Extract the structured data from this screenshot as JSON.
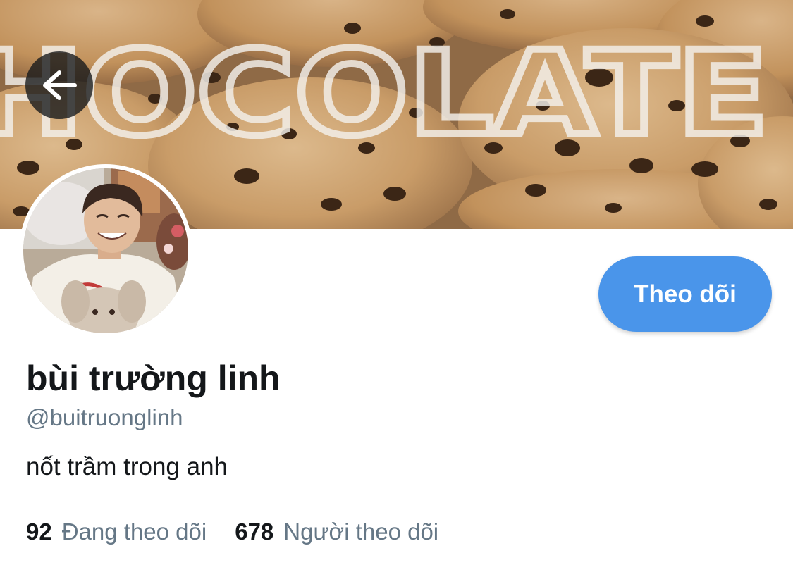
{
  "header": {
    "back_icon": "arrow-left-icon",
    "banner_text": "HOCOLATE"
  },
  "profile": {
    "display_name": "bùi trường linh",
    "handle": "@buitruonglinh",
    "bio": "nốt trầm trong anh",
    "follow_label": "Theo dõi"
  },
  "stats": {
    "following_count": "92",
    "following_label": "Đang theo dõi",
    "followers_count": "678",
    "followers_label": "Người theo dõi"
  },
  "colors": {
    "accent": "#4a95ea",
    "text_primary": "#14171a",
    "text_secondary": "#657786"
  }
}
